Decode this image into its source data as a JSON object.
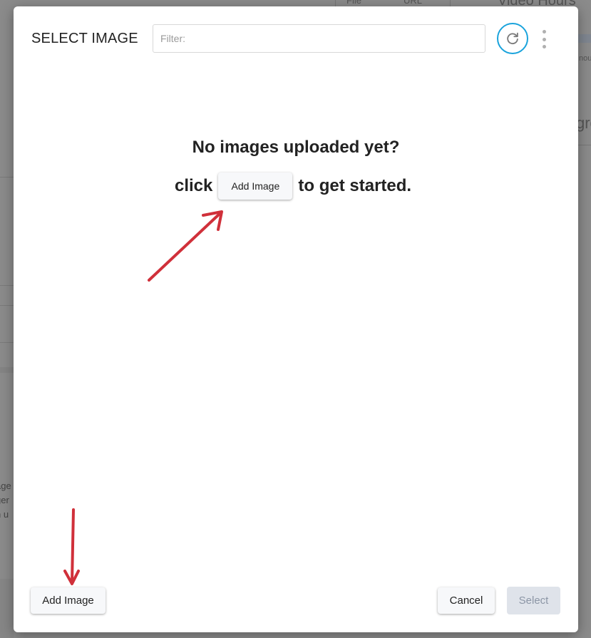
{
  "background": {
    "file_label": "File",
    "url_label": "URL",
    "video_hours": "Video Hours",
    "right_snippet_1": "nou",
    "right_snippet_2": "gre",
    "left_snippet": [
      "age",
      "ger",
      "n u"
    ]
  },
  "modal": {
    "title": "SELECT IMAGE",
    "filter": {
      "placeholder": "Filter:",
      "value": ""
    },
    "refresh_icon": "refresh-icon",
    "more_icon": "kebab-menu-icon",
    "empty_state": {
      "heading": "No images uploaded yet?",
      "prefix": "click",
      "button_label": "Add Image",
      "suffix": "to get started."
    },
    "footer": {
      "add_image_label": "Add Image",
      "cancel_label": "Cancel",
      "select_label": "Select",
      "select_disabled": true
    }
  },
  "annotation_color": "#d0303a",
  "accent_color": "#1aa3dc"
}
